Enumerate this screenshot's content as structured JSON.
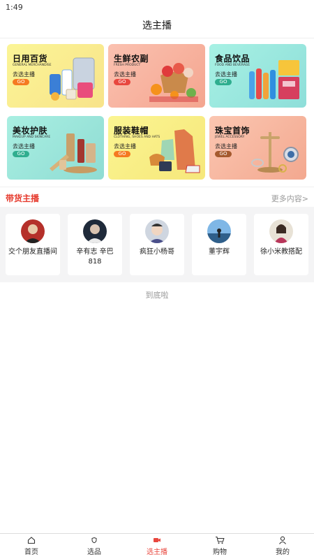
{
  "status_bar": {
    "time": "1:49"
  },
  "header": {
    "title": "选主播"
  },
  "categories": [
    {
      "title": "日用百货",
      "subtitle": "GENERAL MERCHANDISE",
      "cta": "去选主播",
      "go": "GO"
    },
    {
      "title": "生鲜农副",
      "subtitle": "FRESH PRODUCT",
      "cta": "去选主播",
      "go": "GO"
    },
    {
      "title": "食品饮品",
      "subtitle": "FOOD AND BEVERAGE",
      "cta": "去选主播",
      "go": "GO"
    },
    {
      "title": "美妆护肤",
      "subtitle": "MAKEUP AND SKINCARE",
      "cta": "去选主播",
      "go": "GO"
    },
    {
      "title": "服装鞋帽",
      "subtitle": "CLOTHING, SHOES AND HATS",
      "cta": "去选主播",
      "go": "GO"
    },
    {
      "title": "珠宝首饰",
      "subtitle": "JEWEL ACCESSORY",
      "cta": "去选主播",
      "go": "GO"
    }
  ],
  "anchors_section": {
    "title": "带货主播",
    "more": "更多内容>"
  },
  "anchors": [
    {
      "name": "交个朋友直播间"
    },
    {
      "name": "辛有志 辛巴818"
    },
    {
      "name": "疯狂小杨哥"
    },
    {
      "name": "董宇辉"
    },
    {
      "name": "徐小米教搭配"
    }
  ],
  "footer_note": "到底啦",
  "tabbar": [
    {
      "label": "首页",
      "icon": "home-icon",
      "active": false
    },
    {
      "label": "选品",
      "icon": "shield-icon",
      "active": false
    },
    {
      "label": "选主播",
      "icon": "video-icon",
      "active": true
    },
    {
      "label": "购物",
      "icon": "cart-icon",
      "active": false
    },
    {
      "label": "我的",
      "icon": "user-icon",
      "active": false
    }
  ],
  "colors": {
    "accent": "#e8473e",
    "section_title": "#e63b2e"
  }
}
